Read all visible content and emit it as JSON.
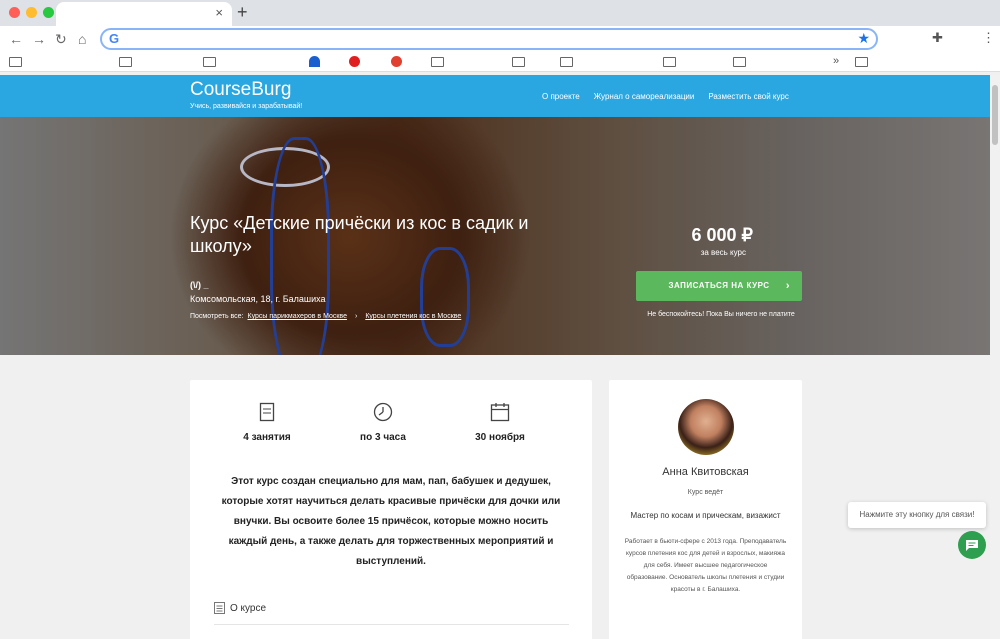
{
  "browser": {
    "new_tab": "+",
    "close_tab": "×",
    "nav": {
      "back": "←",
      "forward": "→",
      "reload": "↻",
      "home": "⌂"
    },
    "extensions": "✚",
    "menu": "⋮",
    "bookmarks_more": "»",
    "star": "★",
    "google_letter": "G"
  },
  "site": {
    "logo": "CourseBurg",
    "tagline": "Учись, развивайся и зарабатывай!",
    "nav": [
      "О проекте",
      "Журнал о самореализации",
      "Разместить свой курс"
    ]
  },
  "hero": {
    "title": "Курс «Детские причёски из кос в садик и школу»",
    "rating": "(\\/) _",
    "address": "Комсомольская, 18, г. Балашиха",
    "see_all_label": "Посмотреть все:",
    "links": [
      "Курсы парикмахеров в Москве",
      "Курсы плетения кос в Москве"
    ],
    "separator": "›",
    "price": "6 000 ₽",
    "price_sub": "за весь курс",
    "enroll_button": "ЗАПИСАТЬСЯ НА КУРС",
    "enroll_chevron": "›",
    "no_worry": "Не беспокойтесь! Пока Вы ничего не платите"
  },
  "stats": [
    {
      "icon": "document-icon",
      "label": "4 занятия"
    },
    {
      "icon": "clock-icon",
      "label": "по 3 часа"
    },
    {
      "icon": "calendar-icon",
      "label": "30 ноября"
    }
  ],
  "description": "Этот курс создан специально для мам, пап, бабушек и дедушек, которые хотят научиться делать красивые причёски для дочки или внучки. Вы освоите более 15 причёсок, которые можно носить каждый день, а также делать для торжественных мероприятий и выступлений.",
  "about_label": "О курсе",
  "author": {
    "name": "Анна Квитовская",
    "role": "Курс ведёт",
    "title": "Мастер по косам и прическам, визажист",
    "bio": "Работает в бьюти-сфере с 2013 года. Преподаватель курсов плетения кос для детей и взрослых, макияжа для себя. Имеет высшее педагогическое образование. Основатель школы плетения и студии красоты в г. Балашиха."
  },
  "chat": {
    "tooltip": "Нажмите эту кнопку для связи!"
  },
  "colors": {
    "header": "#2aa6e0",
    "enroll": "#5cb85c",
    "chat": "#2e9e4f"
  }
}
